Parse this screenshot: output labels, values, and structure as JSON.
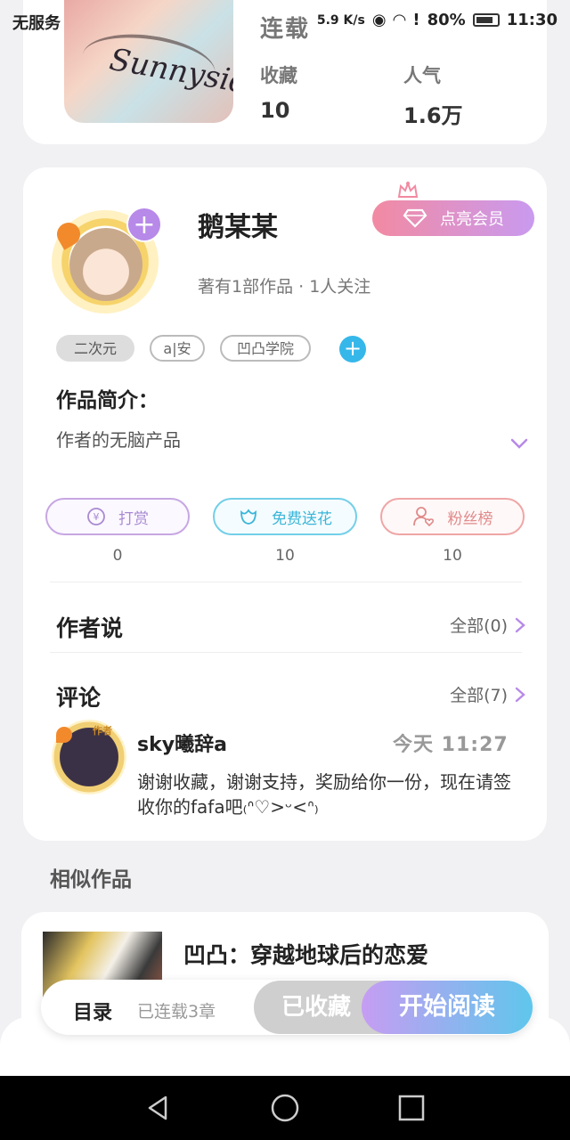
{
  "status_bar": {
    "carrier": "无服务",
    "speed": "5.9 K/s",
    "battery": "80%",
    "time": "11:30"
  },
  "book": {
    "status": "连载",
    "cover_script": "Sunnyside",
    "stats": [
      {
        "label": "收藏",
        "value": "10"
      },
      {
        "label": "人气",
        "value": "1.6万"
      }
    ]
  },
  "author": {
    "name": "鹅某某",
    "vip_label": "点亮会员",
    "meta": "著有1部作品 · 1人关注",
    "tags": [
      "二次元",
      "a|安",
      "凹凸学院"
    ]
  },
  "intro": {
    "title": "作品简介：",
    "text": "作者的无脑产品"
  },
  "actions": [
    {
      "label": "打赏",
      "count": "0"
    },
    {
      "label": "免费送花",
      "count": "10"
    },
    {
      "label": "粉丝榜",
      "count": "10"
    }
  ],
  "author_says": {
    "title": "作者说",
    "link": "全部(0)"
  },
  "comments": {
    "title": "评论",
    "link": "全部(7)",
    "items": [
      {
        "badge": "作者",
        "user": "sky曦辞a",
        "time": "今天 11:27",
        "text": "谢谢收藏，谢谢支持，奖励给你一份，现在请签收你的fafa吧₍ᐢ♡>ᵕ<ᐢ₎"
      }
    ]
  },
  "similar": {
    "title": "相似作品",
    "items": [
      {
        "name": "凹凸：穿越地球后的恋爱"
      }
    ]
  },
  "bottom_bar": {
    "toc": "目录",
    "toc_meta": "已连载3章",
    "collected": "已收藏",
    "read": "开始阅读"
  },
  "colors": {
    "accent_purple": "#b789e8",
    "accent_blue": "#35b7ea",
    "vip_gradient_start": "#f28aa2",
    "vip_gradient_end": "#c99af0"
  }
}
